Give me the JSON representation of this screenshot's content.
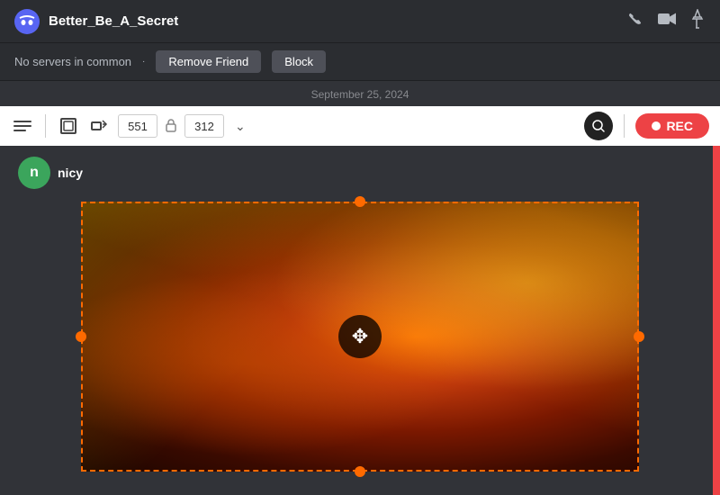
{
  "titleBar": {
    "username": "Better_Be_A_Secret",
    "logoAlt": "discord-logo"
  },
  "userBar": {
    "noServersText": "No servers in common",
    "separator": "·",
    "removeFriendLabel": "Remove Friend",
    "blockLabel": "Block"
  },
  "dateLabel": "September 25, 2024",
  "toolbar": {
    "widthValue": "551",
    "heightValue": "312",
    "recLabel": "REC",
    "chevronLabel": "⌄"
  },
  "mainContent": {
    "userInitial": "n",
    "usernameLabel": "nicy"
  },
  "icons": {
    "phoneIcon": "📞",
    "videoIcon": "📹",
    "pinIcon": "📌",
    "listIcon": "≡",
    "cropIcon": "⊞",
    "resizeIcon": "⊡",
    "lockIcon": "🔒",
    "searchIcon": "🔍",
    "moveCursor": "✥"
  }
}
